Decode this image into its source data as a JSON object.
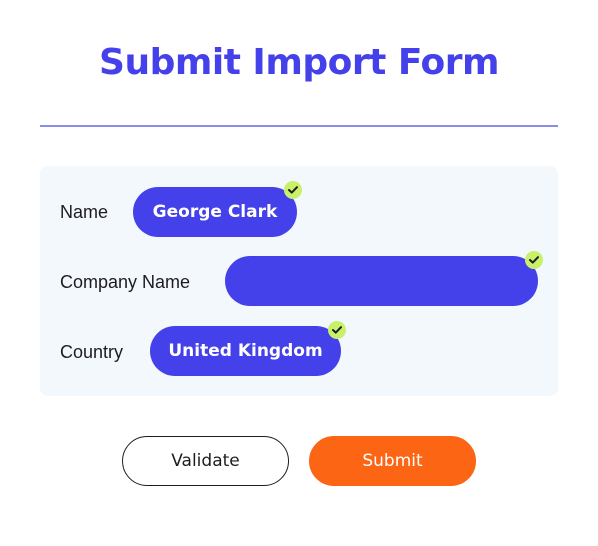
{
  "form": {
    "title": "Submit Import Form",
    "fields": [
      {
        "label": "Name",
        "value": "George Clark",
        "validated": true
      },
      {
        "label": "Company Name",
        "value": "",
        "validated": true
      },
      {
        "label": "Country",
        "value": "United Kingdom",
        "validated": true
      }
    ],
    "validate_label": "Validate",
    "submit_label": "Submit"
  },
  "colors": {
    "accent": "#4441ea",
    "submit": "#fb6514",
    "check_badge": "#c8f169",
    "form_background": "#f3f8fd"
  },
  "icons": {
    "validated": "check-icon"
  }
}
